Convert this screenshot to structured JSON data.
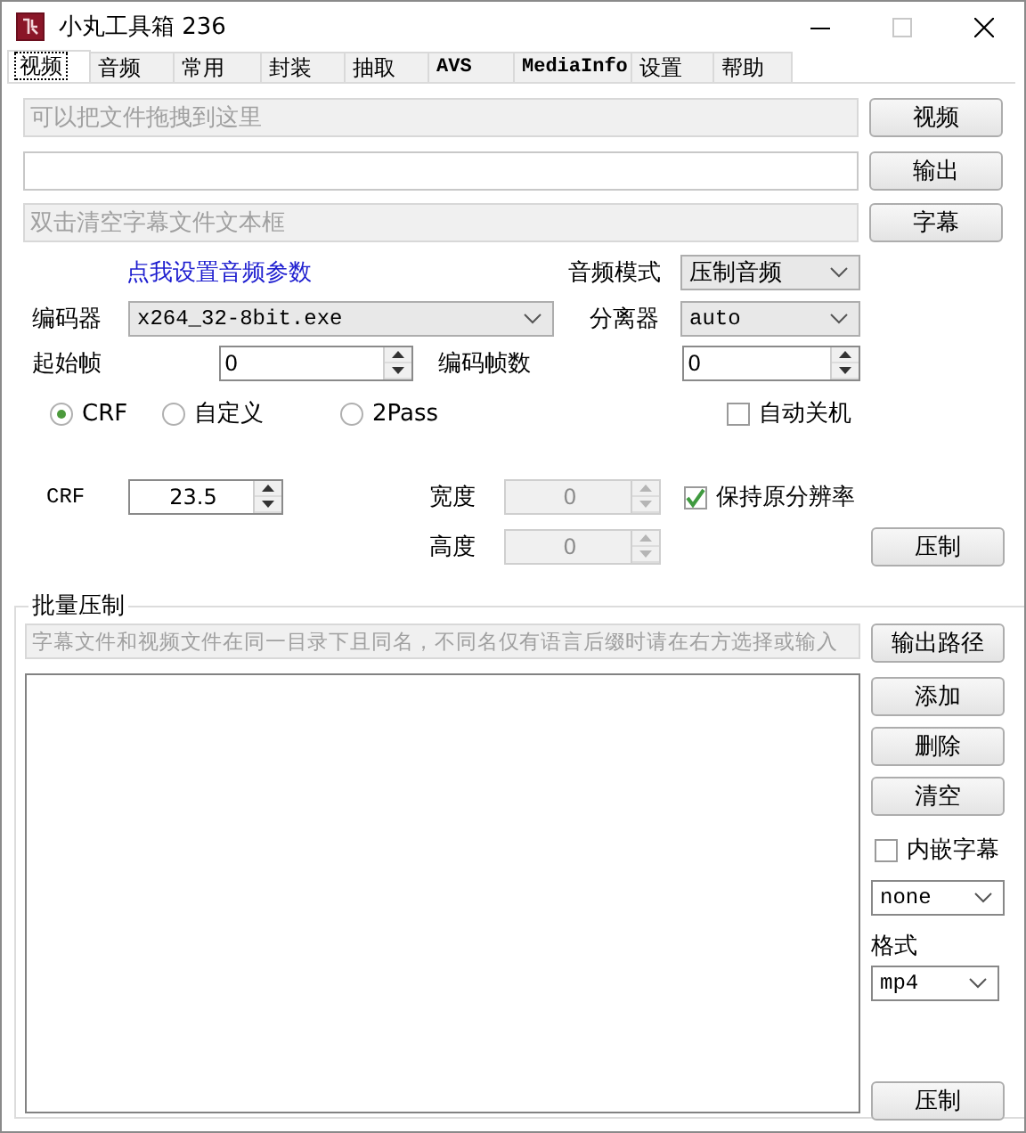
{
  "window": {
    "title": "小丸工具箱 236"
  },
  "tabs": [
    {
      "label": "视频",
      "selected": true
    },
    {
      "label": "音频",
      "selected": false
    },
    {
      "label": "常用",
      "selected": false
    },
    {
      "label": "封装",
      "selected": false
    },
    {
      "label": "抽取",
      "selected": false
    },
    {
      "label": "AVS",
      "selected": false
    },
    {
      "label": "MediaInfo",
      "selected": false
    },
    {
      "label": "设置",
      "selected": false
    },
    {
      "label": "帮助",
      "selected": false
    }
  ],
  "file_rows": [
    {
      "placeholder": "可以把文件拖拽到这里",
      "disabled": true,
      "button": "视频"
    },
    {
      "disabled": false,
      "button": "输出"
    },
    {
      "placeholder": "双击清空字幕文件文本框",
      "disabled": true,
      "button": "字幕"
    }
  ],
  "audio_link": "点我设置音频参数",
  "audio_mode": {
    "label": "音频模式",
    "value": "压制音频"
  },
  "encoder": {
    "label": "编码器",
    "value": "x264_32-8bit.exe"
  },
  "demuxer": {
    "label": "分离器",
    "value": "auto"
  },
  "start_frame": {
    "label": "起始帧",
    "value": "0"
  },
  "frame_count": {
    "label": "编码帧数",
    "value": "0"
  },
  "rate_modes": [
    {
      "label": "CRF",
      "selected": true
    },
    {
      "label": "自定义",
      "selected": false
    },
    {
      "label": "2Pass",
      "selected": false
    }
  ],
  "auto_shutdown": {
    "label": "自动关机",
    "checked": false
  },
  "crf": {
    "label": "CRF",
    "value": "23.5"
  },
  "width": {
    "label": "宽度",
    "value": "0",
    "disabled": true
  },
  "height": {
    "label": "高度",
    "value": "0",
    "disabled": true
  },
  "keep_resolution": {
    "label": "保持原分辨率",
    "checked": true
  },
  "encode_button": "压制",
  "batch": {
    "title": "批量压制",
    "subtitle_field": {
      "placeholder": "字幕文件和视频文件在同一目录下且同名，不同名仅有语言后缀时请在右方选择或输入"
    },
    "output_path_button": "输出路径",
    "buttons": [
      "添加",
      "删除",
      "清空"
    ],
    "embed_subtitles": {
      "label": "内嵌字幕",
      "checked": false
    },
    "subtitle_lang": {
      "value": "none"
    },
    "format": {
      "label": "格式",
      "value": "mp4"
    },
    "encode_button": "压制"
  }
}
